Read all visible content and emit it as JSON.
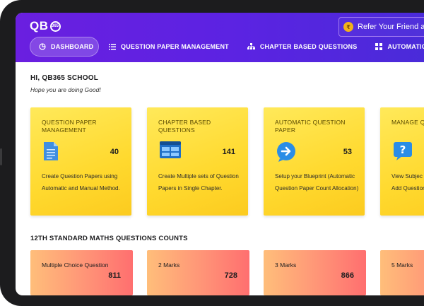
{
  "header": {
    "logo": "QB",
    "logo_badge": "365",
    "refer_coin": "₹",
    "refer_text": "Refer Your Friend and Ea"
  },
  "nav": [
    {
      "label": "DASHBOARD",
      "icon": "pie-chart-icon",
      "active": true
    },
    {
      "label": "QUESTION PAPER MANAGEMENT",
      "icon": "list-icon"
    },
    {
      "label": "CHAPTER BASED QUESTIONS",
      "icon": "hierarchy-icon"
    },
    {
      "label": "AUTOMATIC QUEST",
      "icon": "grid-icon"
    }
  ],
  "greeting": {
    "title": "HI, QB365 SCHOOL",
    "subtitle": "Hope you are doing Good!"
  },
  "cards": [
    {
      "title": "QUESTION PAPER MANAGEMENT",
      "count": "40",
      "icon": "document-icon",
      "desc": "Create Question Papers using Automatic and Manual Method."
    },
    {
      "title": "CHAPTER BASED QUESTIONS",
      "count": "141",
      "icon": "window-grid-icon",
      "desc": "Create Multiple sets of Question Papers in Single Chapter."
    },
    {
      "title": "AUTOMATIC QUESTION PAPER",
      "count": "53",
      "icon": "arrow-circle-icon",
      "desc": "Setup your Blueprint (Automatic Question Paper Count Allocation)"
    },
    {
      "title": "MANAGE Q",
      "count": "",
      "icon": "question-bubble-icon",
      "desc": "View Subjec Question Ty Counts. Add Questions."
    }
  ],
  "counts_section": {
    "title": "12TH STANDARD MATHS QUESTIONS COUNTS",
    "items": [
      {
        "label": "Multiple Choice Question",
        "value": "811"
      },
      {
        "label": "2 Marks",
        "value": "728"
      },
      {
        "label": "3 Marks",
        "value": "866"
      },
      {
        "label": "5 Marks",
        "value": ""
      }
    ]
  },
  "colors": {
    "header_start": "#6a1fe0",
    "header_end": "#4a2bd9",
    "card_yellow": "#ffd92e",
    "count_gradient_start": "#ffbe7a",
    "count_gradient_end": "#ff6f6f"
  }
}
